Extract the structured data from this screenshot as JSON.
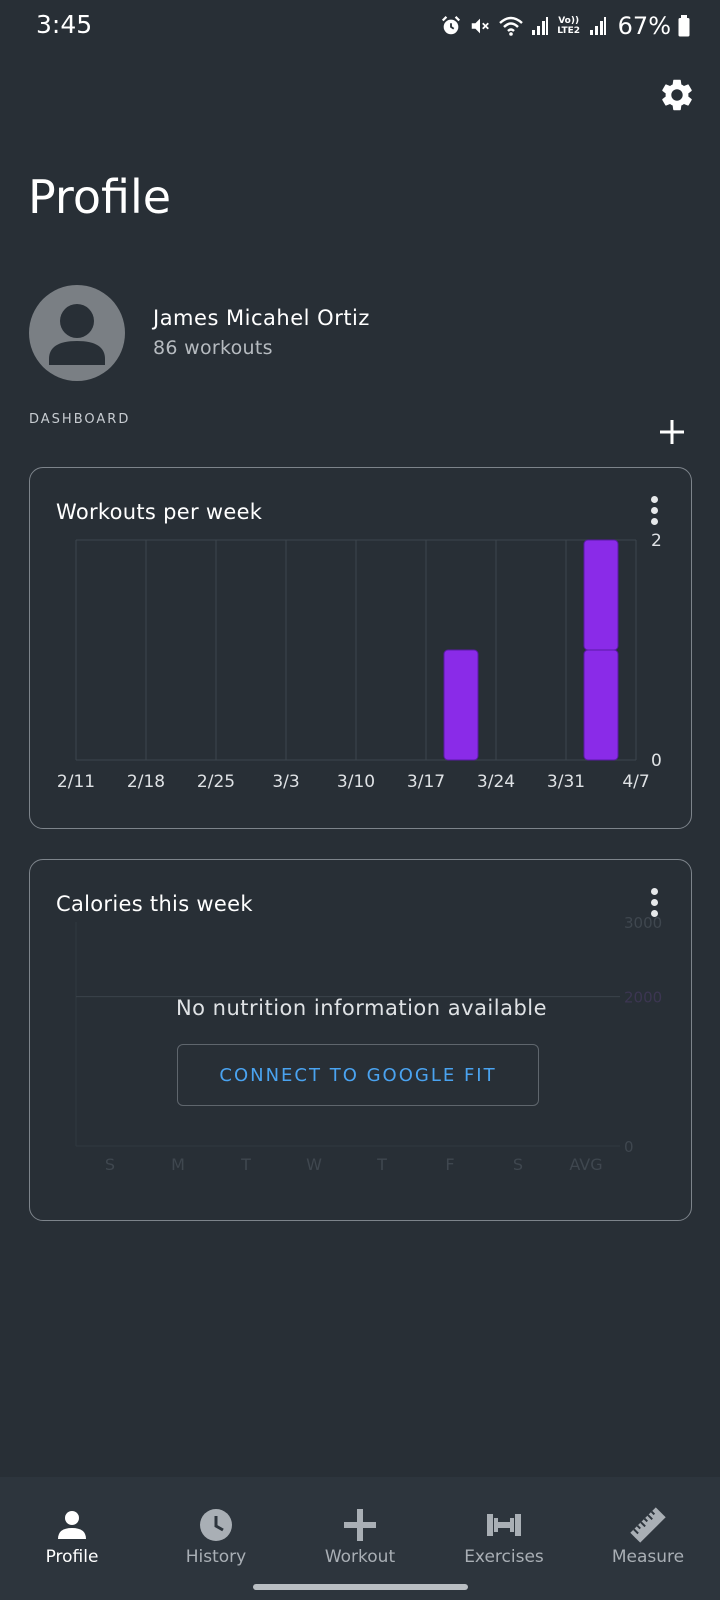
{
  "status_bar": {
    "time": "3:45",
    "network_label": "Vo)) LTE2",
    "battery": "67%"
  },
  "page": {
    "title": "Profile"
  },
  "profile": {
    "name": "James Micahel Ortiz",
    "workouts": "86 workouts"
  },
  "dashboard": {
    "label": "DASHBOARD"
  },
  "cards": {
    "workouts_per_week": {
      "title": "Workouts per week"
    },
    "calories": {
      "title": "Calories this week",
      "empty_message": "No nutrition information available",
      "connect_label": "CONNECT TO GOOGLE FIT"
    }
  },
  "chart_data": [
    {
      "type": "bar",
      "title": "Workouts per week",
      "x_tick_labels": [
        "2/11",
        "2/18",
        "2/25",
        "3/3",
        "3/10",
        "3/17",
        "3/24",
        "3/31",
        "4/7"
      ],
      "categories": [
        "2/11",
        "2/18",
        "2/25",
        "3/3",
        "3/10",
        "3/17",
        "3/24",
        "3/31"
      ],
      "values": [
        0,
        0,
        0,
        0,
        0,
        1,
        0,
        2
      ],
      "y_tick_labels": [
        "2",
        "0"
      ],
      "ylim": [
        0,
        2
      ],
      "bar_color": "#8a2be8",
      "grid": true
    },
    {
      "type": "bar",
      "title": "Calories this week",
      "categories": [
        "S",
        "M",
        "T",
        "W",
        "T",
        "F",
        "S",
        "AVG"
      ],
      "values": [],
      "y_tick_labels": [
        "3000",
        "2000",
        "0"
      ],
      "ylim": [
        0,
        3000
      ],
      "grid": true
    }
  ],
  "bottom_nav": {
    "items": [
      {
        "label": "Profile",
        "icon": "person-icon",
        "active": true
      },
      {
        "label": "History",
        "icon": "clock-icon",
        "active": false
      },
      {
        "label": "Workout",
        "icon": "plus-icon",
        "active": false
      },
      {
        "label": "Exercises",
        "icon": "dumbbell-icon",
        "active": false
      },
      {
        "label": "Measure",
        "icon": "ruler-icon",
        "active": false
      }
    ]
  },
  "colors": {
    "background": "#282f36",
    "nav_background": "#2d353d",
    "accent_bar": "#8a2be8",
    "link": "#4aa3f0"
  }
}
